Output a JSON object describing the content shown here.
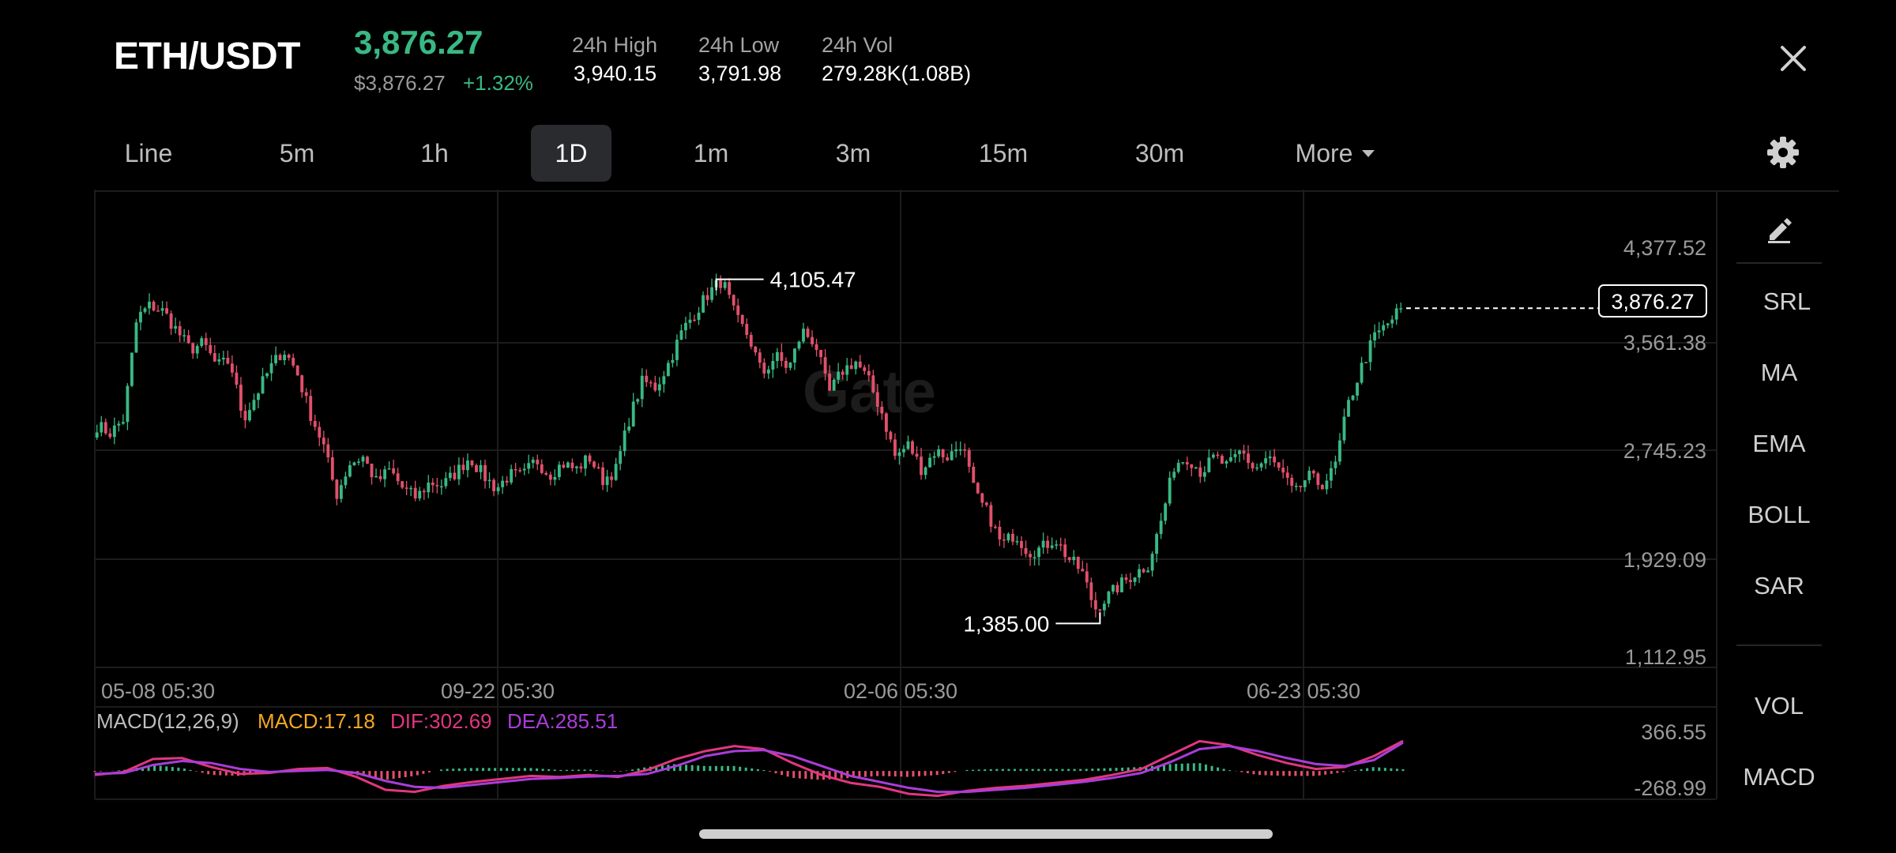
{
  "header": {
    "pair": "ETH/USDT",
    "last_price": "3,876.27",
    "last_price_usd": "$3,876.27",
    "change_pct": "+1.32%",
    "stats": [
      {
        "label": "24h High",
        "value": "3,940.15"
      },
      {
        "label": "24h Low",
        "value": "3,791.98"
      },
      {
        "label": "24h Vol",
        "value": "279.28K(1.08B)"
      }
    ],
    "close_icon": "close-icon"
  },
  "intervals": {
    "items": [
      "Line",
      "5m",
      "1h",
      "1D",
      "1m",
      "3m",
      "15m",
      "30m"
    ],
    "active": "1D",
    "more_label": "More",
    "settings_icon": "gear-icon"
  },
  "colors": {
    "up": "#39b883",
    "down": "#e0506a",
    "macd": "#f5a623",
    "dif": "#e0377f",
    "dea": "#a93dd8"
  },
  "chart_data": {
    "type": "candlestick",
    "watermark": "Gate",
    "price_axis": [
      "4,377.52",
      "3,561.38",
      "2,745.23",
      "1,929.09",
      "1,112.95"
    ],
    "time_axis": [
      "05-08 05:30",
      "09-22 05:30",
      "02-06 05:30",
      "06-23 05:30"
    ],
    "current_price_label": "3,876.27",
    "max_label": "4,105.47",
    "min_label": "1,385.00",
    "current_price": 3876.27,
    "high": 4105.47,
    "low": 1385.0,
    "ylim": [
      1112.95,
      4377.52
    ],
    "close_path": [
      2950,
      2890,
      3000,
      3800,
      3900,
      3850,
      3700,
      3550,
      3600,
      3420,
      3460,
      3000,
      3200,
      3400,
      3550,
      3380,
      3050,
      2800,
      2400,
      2650,
      2700,
      2500,
      2600,
      2450,
      2380,
      2500,
      2480,
      2580,
      2700,
      2560,
      2450,
      2560,
      2550,
      2680,
      2560,
      2650,
      2600,
      2700,
      2520,
      2600,
      3000,
      3300,
      3250,
      3450,
      3700,
      3850,
      4000,
      4100,
      3800,
      3650,
      3350,
      3500,
      3400,
      3700,
      3600,
      3200,
      3380,
      3460,
      3300,
      3050,
      2700,
      2800,
      2600,
      2750,
      2700,
      2820,
      2400,
      2250,
      2000,
      2100,
      1950,
      1980,
      2060,
      1900,
      1800,
      1500,
      1600,
      1700,
      1780,
      1850,
      2200,
      2650,
      2700,
      2580,
      2700,
      2620,
      2750,
      2600,
      2700,
      2580,
      2400,
      2550,
      2480,
      2600,
      3100,
      3400,
      3650,
      3750,
      3876
    ]
  },
  "macd": {
    "label": "MACD(12,26,9)",
    "macd_text": "MACD:17.18",
    "dif_text": "DIF:302.69",
    "dea_text": "DEA:285.51",
    "axis": [
      "366.55",
      "-268.99"
    ],
    "ylim": [
      -268.99,
      366.55
    ],
    "dif": [
      -40,
      -10,
      120,
      130,
      40,
      -30,
      -20,
      20,
      30,
      -60,
      -190,
      -210,
      -150,
      -110,
      -80,
      -50,
      -60,
      -40,
      -60,
      10,
      120,
      200,
      250,
      220,
      80,
      -40,
      -120,
      -160,
      -230,
      -250,
      -200,
      -170,
      -150,
      -120,
      -90,
      -40,
      20,
      160,
      300,
      260,
      160,
      80,
      20,
      40,
      150,
      302.69
    ],
    "dea": [
      -30,
      -20,
      60,
      100,
      80,
      20,
      -10,
      0,
      10,
      -20,
      -100,
      -160,
      -170,
      -140,
      -110,
      -80,
      -70,
      -55,
      -50,
      -30,
      50,
      150,
      200,
      210,
      150,
      50,
      -50,
      -110,
      -170,
      -210,
      -210,
      -190,
      -170,
      -140,
      -110,
      -70,
      -20,
      90,
      220,
      250,
      200,
      130,
      70,
      50,
      110,
      285.51
    ]
  },
  "tools": {
    "edit_icon": "pencil-icon",
    "items": [
      "SRL",
      "MA",
      "EMA",
      "BOLL",
      "SAR"
    ],
    "secondary": [
      "VOL",
      "MACD"
    ]
  }
}
